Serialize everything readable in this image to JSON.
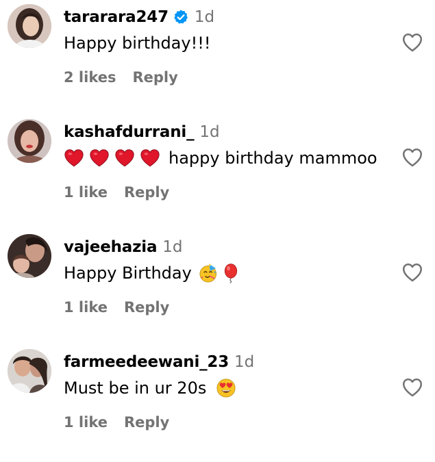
{
  "comments": [
    {
      "username": "tararara247",
      "verified": true,
      "time": "1d",
      "text": "Happy birthday!!!",
      "likes": "2 likes",
      "reply": "Reply",
      "emojis_before": [],
      "emojis_after": []
    },
    {
      "username": "kashafdurrani_",
      "verified": false,
      "time": "1d",
      "text": "happy birthday mammoo",
      "likes": "1 like",
      "reply": "Reply",
      "emojis_before": [
        "red-heart",
        "red-heart",
        "red-heart",
        "red-heart"
      ],
      "emojis_after": []
    },
    {
      "username": "vajeehazia",
      "verified": false,
      "time": "1d",
      "text": "Happy Birthday",
      "likes": "1 like",
      "reply": "Reply",
      "emojis_before": [],
      "emojis_after": [
        "partying-face",
        "balloon"
      ]
    },
    {
      "username": "farmeedeewani_23",
      "verified": false,
      "time": "1d",
      "text": "Must be in ur 20s",
      "likes": "1 like",
      "reply": "Reply",
      "emojis_before": [],
      "emojis_after": [
        "heart-eyes"
      ]
    }
  ],
  "colors": {
    "username": "#000000",
    "secondary_text": "#737373",
    "verified_badge": "#0095f6",
    "heart_outline": "#737373",
    "emoji_heart": "#e0162b"
  },
  "icons": {
    "verified": "verified-badge-icon",
    "like": "heart-outline-icon"
  }
}
